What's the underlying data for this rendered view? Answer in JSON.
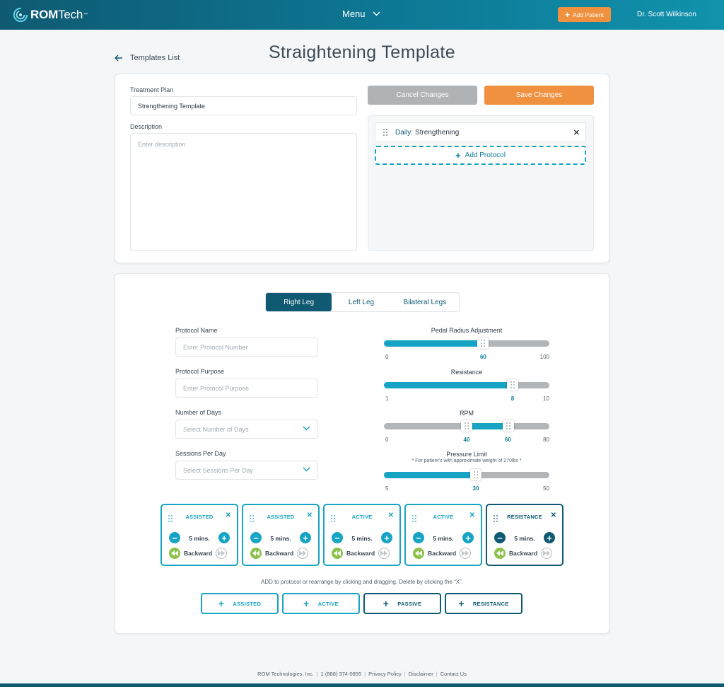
{
  "header": {
    "logo_bold": "ROM",
    "logo_light": "Tech",
    "logo_tm": "™",
    "menu_label": "Menu",
    "add_patient_label": "Add Patient",
    "doctor_name": "Dr. Scott Wilkinson"
  },
  "nav": {
    "back_label": "Templates List",
    "page_title": "Straightening Template"
  },
  "plan": {
    "treatment_plan_label": "Treatment Plan",
    "treatment_plan_value": "Strengthening Template",
    "description_label": "Description",
    "description_placeholder": "Enter description",
    "cancel_label": "Cancel Changes",
    "save_label": "Save Changes",
    "protocol_item_prefix": "Daily:",
    "protocol_item_name": "Strengthening",
    "close_glyph": "✕",
    "add_protocol_label": "Add Protocol"
  },
  "tabs": [
    {
      "label": "Right Leg",
      "active": true
    },
    {
      "label": "Left Leg",
      "active": false
    },
    {
      "label": "Bilateral Legs",
      "active": false
    }
  ],
  "form": {
    "protocol_name_label": "Protocol Name",
    "protocol_name_placeholder": "Enter Protocol Number",
    "protocol_purpose_label": "Protocol Purpose",
    "protocol_purpose_placeholder": "Enter Protocol Purpose",
    "days_label": "Number of Days",
    "days_placeholder": "Select Number of Days",
    "sessions_label": "Sessions Per Day",
    "sessions_placeholder": "Select Sessions Per Day"
  },
  "sliders": {
    "pedal": {
      "title": "Pedal Radius Adjustment",
      "min": 0,
      "max": 100,
      "value": 60,
      "min_label": "0",
      "max_label": "100",
      "value_label": "60"
    },
    "resistance": {
      "title": "Resistance",
      "min": 1,
      "max": 10,
      "value": 8,
      "min_label": "1",
      "max_label": "10",
      "value_label": "8"
    },
    "rpm": {
      "title": "RPM",
      "min": 0,
      "max": 80,
      "low": 40,
      "high": 60,
      "min_label": "0",
      "max_label": "80",
      "low_label": "40",
      "high_label": "60"
    },
    "pressure": {
      "title": "Pressure Limit",
      "note": "* For patient's with approximate weight of 270lbs *",
      "min": 5,
      "max": 50,
      "value": 30,
      "min_label": "5",
      "max_label": "50",
      "value_label": "30"
    }
  },
  "cards": [
    {
      "title": "ASSISTED",
      "duration": "5 mins.",
      "direction": "Backward",
      "dark": false
    },
    {
      "title": "ASSISTED",
      "duration": "5 mins.",
      "direction": "Backward",
      "dark": false
    },
    {
      "title": "ACTIVE",
      "duration": "5 mins.",
      "direction": "Backward",
      "dark": false
    },
    {
      "title": "ACTIVE",
      "duration": "5 mins.",
      "direction": "Backward",
      "dark": false
    },
    {
      "title": "RESISTANCE",
      "duration": "5 mins.",
      "direction": "Backward",
      "dark": true
    }
  ],
  "hint": "ADD to protocol or rearrange by clicking and dragging. Delete by clicking the “X”.",
  "add_buttons": [
    {
      "label": "ASSISTED",
      "dark": false
    },
    {
      "label": "ACTIVE",
      "dark": false
    },
    {
      "label": "PASSIVE",
      "dark": true
    },
    {
      "label": "RESISTANCE",
      "dark": true
    }
  ],
  "footer": {
    "company": "ROM Technologies, Inc.",
    "phone": "1 (888) 374-0855",
    "privacy": "Privacy Policy",
    "disclaimer": "Disclaimer",
    "contact": "Contact Us",
    "separator": "|"
  },
  "colors": {
    "primary": "#0f5a72",
    "accent": "#17a4c4",
    "orange": "#f0913f",
    "grey_button": "#b0b3b6",
    "green": "#8bc34a"
  }
}
